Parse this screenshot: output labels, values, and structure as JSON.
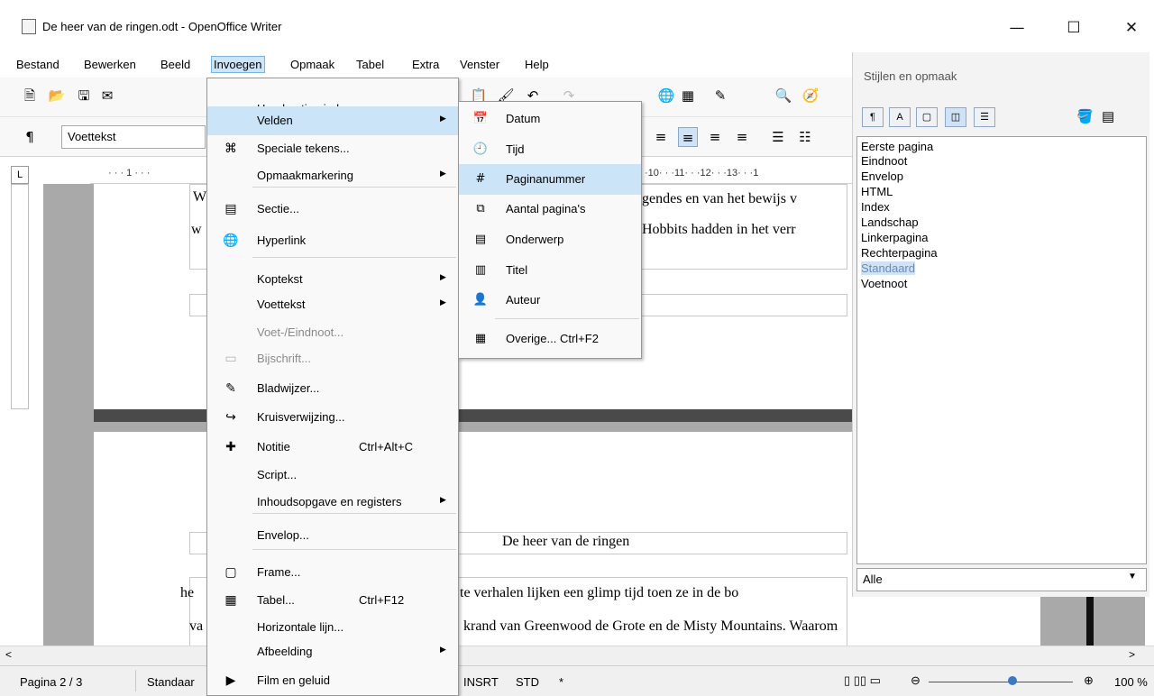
{
  "window": {
    "title": "De heer van de ringen.odt - OpenOffice Writer",
    "minimize": "—",
    "maximize": "☐",
    "close": "✕"
  },
  "menubar": [
    "Bestand",
    "Bewerken",
    "Beeld",
    "Invoegen",
    "Opmaak",
    "Tabel",
    "Extra",
    "Venster",
    "Help"
  ],
  "toolbar": {
    "paragraph_style": "Voettekst"
  },
  "ruler": {
    "left_marks": "· · · 1 · · ·",
    "right_marks": "·10· · ·11· · ·12· · ·13· · ·1"
  },
  "document": {
    "top_line1_start": "W",
    "top_line1_end": "gendes en van het bewijs v",
    "top_line2_start": "w",
    "top_line2_end": "Hobbits hadden in het verr",
    "header_text": "De heer van de ringen",
    "line3_start": "he",
    "line3_end": "te verhalen lijken een glimp tijd toen ze in de bo",
    "line4_start": "va",
    "line4_end": "krand van Greenwood de Grote en de Misty Mountains. Waarom"
  },
  "insert_menu": {
    "items": [
      {
        "label": "Handmatig einde...",
        "icon": "",
        "shortcut": "",
        "arrow": false,
        "disabled": false,
        "highlight": false
      },
      {
        "label": "Velden",
        "icon": "",
        "shortcut": "",
        "arrow": true,
        "disabled": false,
        "highlight": true
      },
      {
        "label": "Speciale tekens...",
        "icon": "special-chars-icon",
        "shortcut": "",
        "arrow": false,
        "disabled": false,
        "highlight": false
      },
      {
        "label": "Opmaakmarkering",
        "icon": "",
        "shortcut": "",
        "arrow": true,
        "disabled": false,
        "highlight": false
      },
      {
        "label": "Sectie...",
        "icon": "section-icon",
        "shortcut": "",
        "arrow": false,
        "disabled": false,
        "highlight": false
      },
      {
        "label": "Hyperlink",
        "icon": "hyperlink-icon",
        "shortcut": "",
        "arrow": false,
        "disabled": false,
        "highlight": false
      },
      {
        "label": "Koptekst",
        "icon": "",
        "shortcut": "",
        "arrow": true,
        "disabled": false,
        "highlight": false
      },
      {
        "label": "Voettekst",
        "icon": "",
        "shortcut": "",
        "arrow": true,
        "disabled": false,
        "highlight": false
      },
      {
        "label": "Voet-/Eindnoot...",
        "icon": "",
        "shortcut": "",
        "arrow": false,
        "disabled": true,
        "highlight": false
      },
      {
        "label": "Bijschrift...",
        "icon": "caption-icon",
        "shortcut": "",
        "arrow": false,
        "disabled": true,
        "highlight": false
      },
      {
        "label": "Bladwijzer...",
        "icon": "bookmark-icon",
        "shortcut": "",
        "arrow": false,
        "disabled": false,
        "highlight": false
      },
      {
        "label": "Kruisverwijzing...",
        "icon": "cross-reference-icon",
        "shortcut": "",
        "arrow": false,
        "disabled": false,
        "highlight": false
      },
      {
        "label": "Notitie",
        "icon": "comment-icon",
        "shortcut": "Ctrl+Alt+C",
        "arrow": false,
        "disabled": false,
        "highlight": false
      },
      {
        "label": "Script...",
        "icon": "",
        "shortcut": "",
        "arrow": false,
        "disabled": false,
        "highlight": false
      },
      {
        "label": "Inhoudsopgave en registers",
        "icon": "",
        "shortcut": "",
        "arrow": true,
        "disabled": false,
        "highlight": false
      },
      {
        "label": "Envelop...",
        "icon": "",
        "shortcut": "",
        "arrow": false,
        "disabled": false,
        "highlight": false
      },
      {
        "label": "Frame...",
        "icon": "frame-icon",
        "shortcut": "",
        "arrow": false,
        "disabled": false,
        "highlight": false
      },
      {
        "label": "Tabel...",
        "icon": "table-icon",
        "shortcut": "Ctrl+F12",
        "arrow": false,
        "disabled": false,
        "highlight": false
      },
      {
        "label": "Horizontale lijn...",
        "icon": "",
        "shortcut": "",
        "arrow": false,
        "disabled": false,
        "highlight": false
      },
      {
        "label": "Afbeelding",
        "icon": "",
        "shortcut": "",
        "arrow": true,
        "disabled": false,
        "highlight": false
      },
      {
        "label": "Film en geluid",
        "icon": "movie-sound-icon",
        "shortcut": "",
        "arrow": false,
        "disabled": false,
        "highlight": false
      }
    ]
  },
  "fields_menu": {
    "items": [
      {
        "label": "Datum",
        "icon": "calendar-icon",
        "highlight": false
      },
      {
        "label": "Tijd",
        "icon": "clock-icon",
        "highlight": false
      },
      {
        "label": "Paginanummer",
        "icon": "page-number-icon",
        "highlight": true
      },
      {
        "label": "Aantal pagina's",
        "icon": "page-count-icon",
        "highlight": false
      },
      {
        "label": "Onderwerp",
        "icon": "subject-icon",
        "highlight": false
      },
      {
        "label": "Titel",
        "icon": "title-icon",
        "highlight": false
      },
      {
        "label": "Auteur",
        "icon": "author-icon",
        "highlight": false
      },
      {
        "label": "Overige... Ctrl+F2",
        "icon": "other-fields-icon",
        "highlight": false
      }
    ]
  },
  "styles_panel": {
    "title": "Stijlen en opmaak",
    "items": [
      "Eerste pagina",
      "Eindnoot",
      "Envelop",
      "HTML",
      "Index",
      "Landschap",
      "Linkerpagina",
      "Rechterpagina",
      "Standaard",
      "Voetnoot"
    ],
    "selected": "Standaard",
    "filter": "Alle"
  },
  "statusbar": {
    "page": "Pagina 2 / 3",
    "style": "Standaar",
    "mode": "INSRT",
    "selection": "STD",
    "modified": "*",
    "zoom": "100 %"
  },
  "colors": {
    "menu_highlight": "#cce4f7",
    "document_bg": "#a9a9a9",
    "selected_style": "#cfe2f6"
  }
}
